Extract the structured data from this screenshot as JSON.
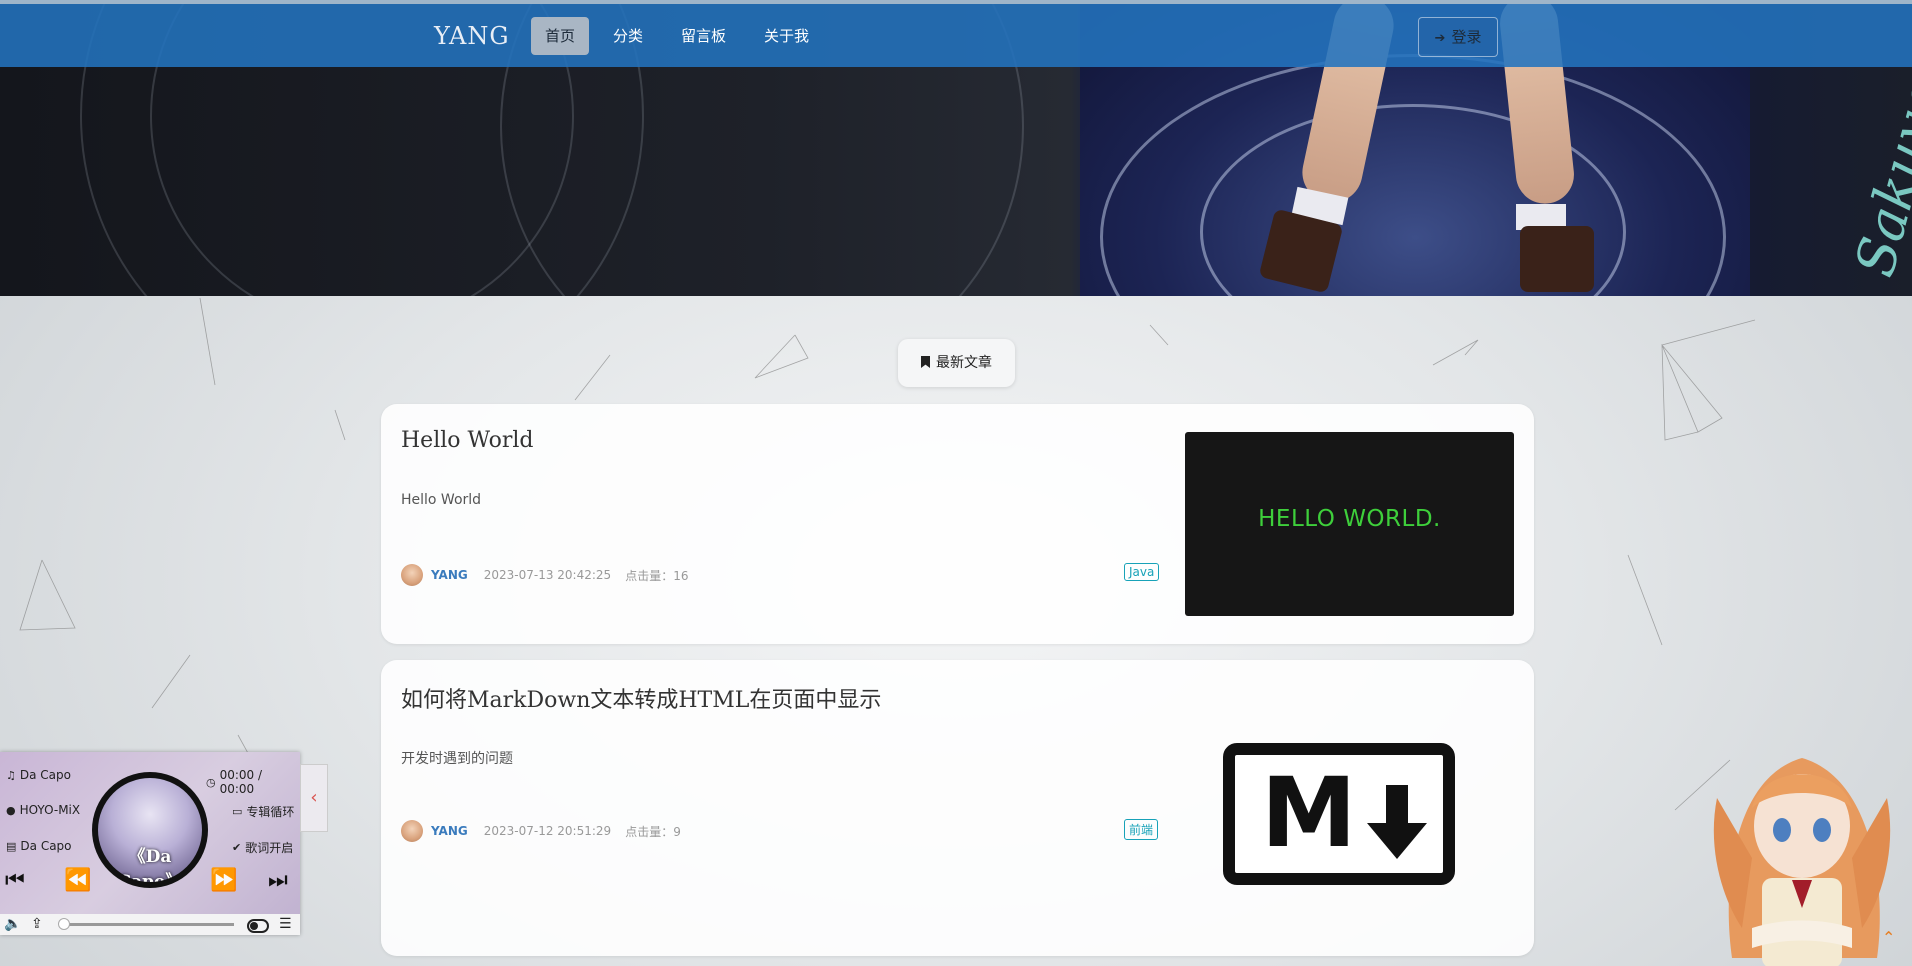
{
  "navbar": {
    "brand": "YANG",
    "items": [
      {
        "label": "首页",
        "active": true
      },
      {
        "label": "分类",
        "active": false
      },
      {
        "label": "留言板",
        "active": false
      },
      {
        "label": "关于我",
        "active": false
      }
    ],
    "login_label": "登录"
  },
  "banner": {
    "signature": "Sakuya"
  },
  "section": {
    "latest_label": "最新文章"
  },
  "posts": [
    {
      "title": "Hello World",
      "summary": "Hello World",
      "author": "YANG",
      "date": "2023-07-13 20:42:25",
      "views": "点击量：16",
      "tag": "Java",
      "thumbnail_text": "HELLO WORLD."
    },
    {
      "title": "如何将MarkDown文本转成HTML在页面中显示",
      "summary": "开发时遇到的问题",
      "author": "YANG",
      "date": "2023-07-12 20:51:29",
      "views": "点击量：9",
      "tag": "前端",
      "thumbnail_text": "M"
    }
  ],
  "player": {
    "song": "Da Capo",
    "artist": "HOYO-MiX",
    "album": "Da Capo",
    "time": "00:00 / 00:00",
    "mode": "专辑循环",
    "lyrics": "歌词开启",
    "cover_text": "《Da Capo》"
  },
  "colors": {
    "navbar": "#2373be",
    "tag": "#17a2b8",
    "author": "#3a7bbd",
    "hello_green": "#3ecf3b"
  }
}
